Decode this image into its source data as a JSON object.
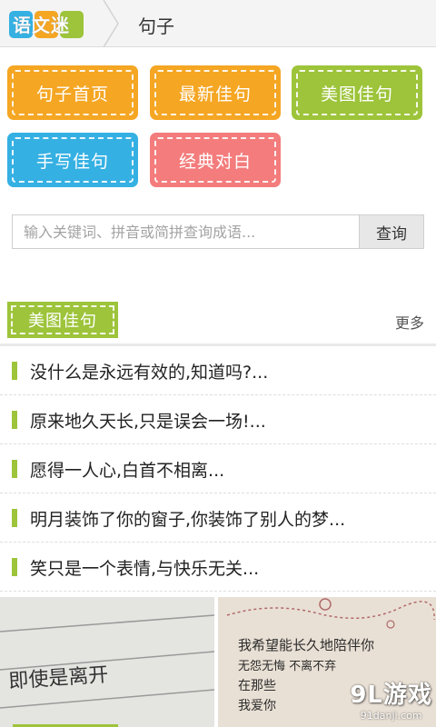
{
  "header": {
    "logo_text": "语文迷",
    "title": "句子"
  },
  "categories": [
    {
      "label": "句子首页",
      "color": "#f5a623"
    },
    {
      "label": "最新佳句",
      "color": "#f5a623"
    },
    {
      "label": "美图佳句",
      "color": "#9dc43a"
    },
    {
      "label": "手写佳句",
      "color": "#35b0e3"
    },
    {
      "label": "经典对白",
      "color": "#f47c7c"
    }
  ],
  "search": {
    "placeholder": "输入关键词、拼音或简拼查询成语...",
    "button_label": "查询"
  },
  "section": {
    "title": "美图佳句",
    "more_label": "更多"
  },
  "list": [
    {
      "text": "没什么是永远有效的,知道吗?..."
    },
    {
      "text": "原来地久天长,只是误会一场!..."
    },
    {
      "text": "愿得一人心,白首不相离..."
    },
    {
      "text": "明月装饰了你的窗子,你装饰了别人的梦..."
    },
    {
      "text": "笑只是一个表情,与快乐无关..."
    }
  ],
  "thumbnails": {
    "left_handwriting": "即使是离开",
    "right_lines": [
      "我希望能长久地陪伴你",
      "无怨无悔   不离不弃",
      "在那些",
      "我爱你"
    ]
  },
  "watermark": {
    "main": "9L游戏",
    "sub": "91danji.com"
  },
  "colors": {
    "accent_green": "#9dc43a",
    "orange": "#f5a623",
    "blue": "#35b0e3",
    "pink": "#f47c7c"
  }
}
